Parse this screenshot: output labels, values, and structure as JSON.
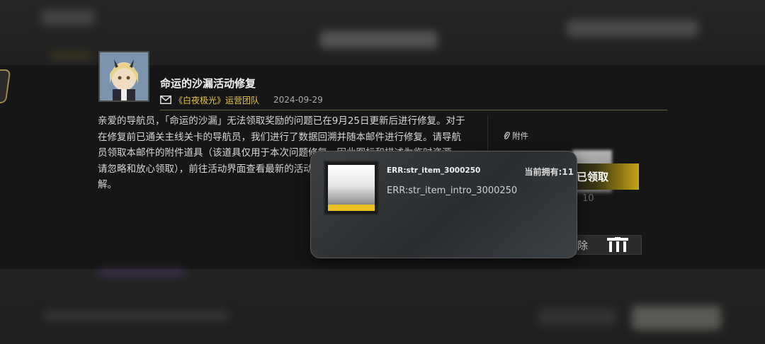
{
  "mail": {
    "title": "命运的沙漏活动修复",
    "sender": "《白夜极光》运营团队",
    "date": "2024-09-29",
    "body": "亲爱的导航员，「命运的沙漏」无法领取奖励的问题已在9月25日更新后进行修复。对于在修复前已通关主线关卡的导航员，我们进行了数据回溯并随本邮件进行修复。请导航员领取本邮件的附件道具（该道具仅用于本次问题修复，因此图标和描述为临时资源，请忽略和放心领取），前往活动界面查看最新的活动情况和领取奖励！造成不便，敬请谅解。"
  },
  "attachments": {
    "label": "附件",
    "claimed_label": "已领取",
    "count": "10",
    "delete_label": "除"
  },
  "popup": {
    "item_name": "ERR:str_item_3000250",
    "owned": "当前拥有:11",
    "intro": "ERR:str_item_intro_3000250"
  },
  "colors": {
    "accent": "#e8c64a",
    "claimed_bar": "#c7a614"
  }
}
